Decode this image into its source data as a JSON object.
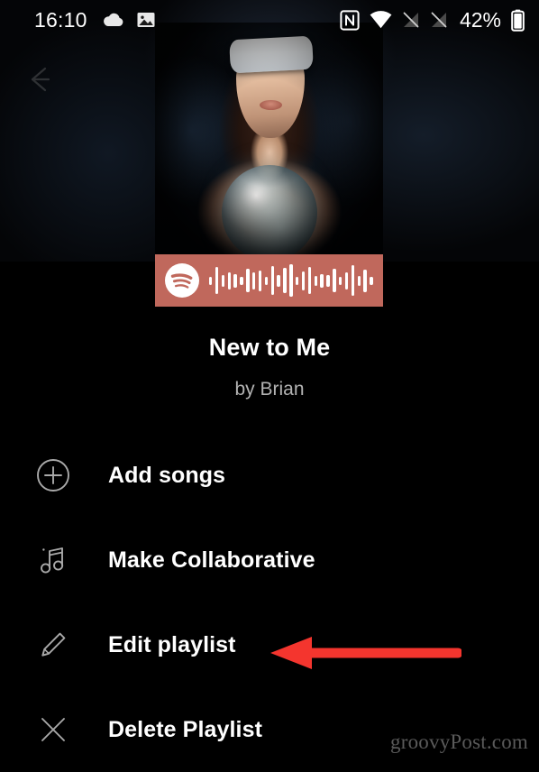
{
  "statusbar": {
    "time": "16:10",
    "battery_text": "42%",
    "icons": [
      {
        "name": "cloud-icon",
        "label": "cloud"
      },
      {
        "name": "screenshot-image-icon",
        "label": "image"
      },
      {
        "name": "nfc-icon",
        "label": "NFC"
      },
      {
        "name": "wifi-icon",
        "label": "Wi-Fi"
      },
      {
        "name": "no-sim-1-icon",
        "label": "no signal 1"
      },
      {
        "name": "no-sim-2-icon",
        "label": "no signal 2"
      },
      {
        "name": "battery-icon",
        "label": "battery"
      }
    ]
  },
  "navigation": {
    "back_label": "Back"
  },
  "hero": {
    "album_art_alt": "Blindfolded woman holding a cloud-filled crystal ball",
    "code_color": "#c0685c",
    "spotify_logo_name": "spotify-logo-icon",
    "code_bar_heights": [
      9,
      30,
      13,
      19,
      15,
      9,
      26,
      19,
      23,
      9,
      32,
      13,
      28,
      36,
      9,
      21,
      30,
      11,
      15,
      13,
      26,
      9,
      19,
      34,
      11,
      25,
      9
    ]
  },
  "playlist": {
    "title": "New to Me",
    "owner": "by Brian"
  },
  "menu": {
    "items": [
      {
        "icon": "plus-circle-icon",
        "label": "Add songs"
      },
      {
        "icon": "music-notes-icon",
        "label": "Make Collaborative"
      },
      {
        "icon": "pencil-icon",
        "label": "Edit playlist"
      },
      {
        "icon": "close-x-icon",
        "label": "Delete Playlist"
      }
    ]
  },
  "annotation": {
    "arrow_color": "#f4352e",
    "arrow_points_to": "Edit playlist"
  },
  "watermark": {
    "text": "groovyPost.com"
  }
}
